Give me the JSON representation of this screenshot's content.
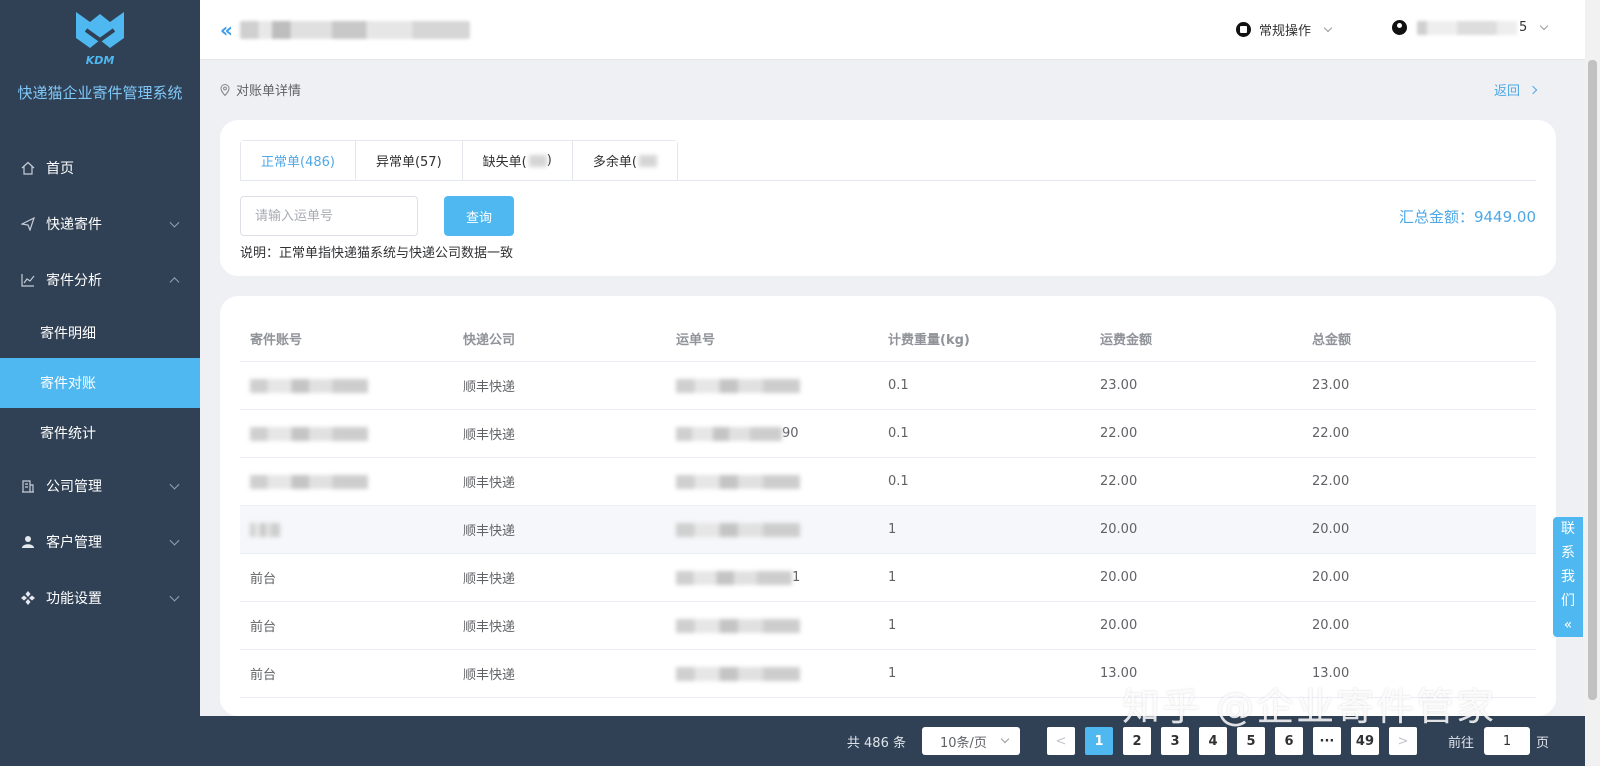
{
  "app": {
    "logo_text": "KDM",
    "name": "快递猫企业寄件管理系统"
  },
  "sidebar": {
    "items": [
      {
        "label": "首页",
        "icon": "home-icon"
      },
      {
        "label": "快递寄件",
        "icon": "send-icon"
      },
      {
        "label": "寄件分析",
        "icon": "chart-icon"
      },
      {
        "label": "寄件明细"
      },
      {
        "label": "寄件对账"
      },
      {
        "label": "寄件统计"
      },
      {
        "label": "公司管理",
        "icon": "building-icon"
      },
      {
        "label": "客户管理",
        "icon": "user-icon"
      },
      {
        "label": "功能设置",
        "icon": "settings-icon"
      }
    ],
    "active": "寄件对账"
  },
  "header": {
    "ops_label": "常规操作",
    "user_suffix": "5"
  },
  "breadcrumb": {
    "label": "对账单详情",
    "back_label": "返回"
  },
  "tabs": [
    {
      "label": "正常单(486)"
    },
    {
      "label": "异常单(57)"
    },
    {
      "label": "缺失单("
    },
    {
      "label": "多余单("
    }
  ],
  "tabs_extra": {
    "missing_suffix": ")"
  },
  "search": {
    "placeholder": "请输入运单号",
    "button_label": "查询"
  },
  "note": "说明：正常单指快递猫系统与快递公司数据一致",
  "total_label": "汇总金额：9449.00",
  "table": {
    "headers": [
      "寄件账号",
      "快递公司",
      "运单号",
      "计费重量(kg)",
      "运费金额",
      "总金额"
    ],
    "rows": [
      {
        "account": "",
        "company": "顺丰快递",
        "waybill_suffix": "",
        "weight": "0.1",
        "freight": "23.00",
        "total": "23.00"
      },
      {
        "account": "",
        "company": "顺丰快递",
        "waybill_suffix": "90",
        "weight": "0.1",
        "freight": "22.00",
        "total": "22.00"
      },
      {
        "account": "",
        "company": "顺丰快递",
        "waybill_suffix": "",
        "weight": "0.1",
        "freight": "22.00",
        "total": "22.00"
      },
      {
        "account": "",
        "company": "顺丰快递",
        "waybill_suffix": "",
        "weight": "1",
        "freight": "20.00",
        "total": "20.00"
      },
      {
        "account": "前台",
        "company": "顺丰快递",
        "waybill_suffix": "1",
        "weight": "1",
        "freight": "20.00",
        "total": "20.00"
      },
      {
        "account": "前台",
        "company": "顺丰快递",
        "waybill_suffix": "",
        "weight": "1",
        "freight": "20.00",
        "total": "20.00"
      },
      {
        "account": "前台",
        "company": "顺丰快递",
        "waybill_suffix": "",
        "weight": "1",
        "freight": "13.00",
        "total": "13.00"
      }
    ]
  },
  "pagination": {
    "total_text": "共 486 条",
    "page_size": "10条/页",
    "pages": [
      "1",
      "2",
      "3",
      "4",
      "5",
      "6",
      "···",
      "49"
    ],
    "current": "1",
    "prev": "<",
    "next": ">",
    "goto_label": "前往",
    "goto_value": "1",
    "page_label": "页"
  },
  "contact": {
    "chars": [
      "联",
      "系",
      "我",
      "们"
    ],
    "arrow": "«"
  },
  "watermark": "知乎 @企业寄件管家",
  "colors": {
    "sidebar_bg": "#304156",
    "accent": "#4fb8f0",
    "link": "#4fa8e6"
  }
}
